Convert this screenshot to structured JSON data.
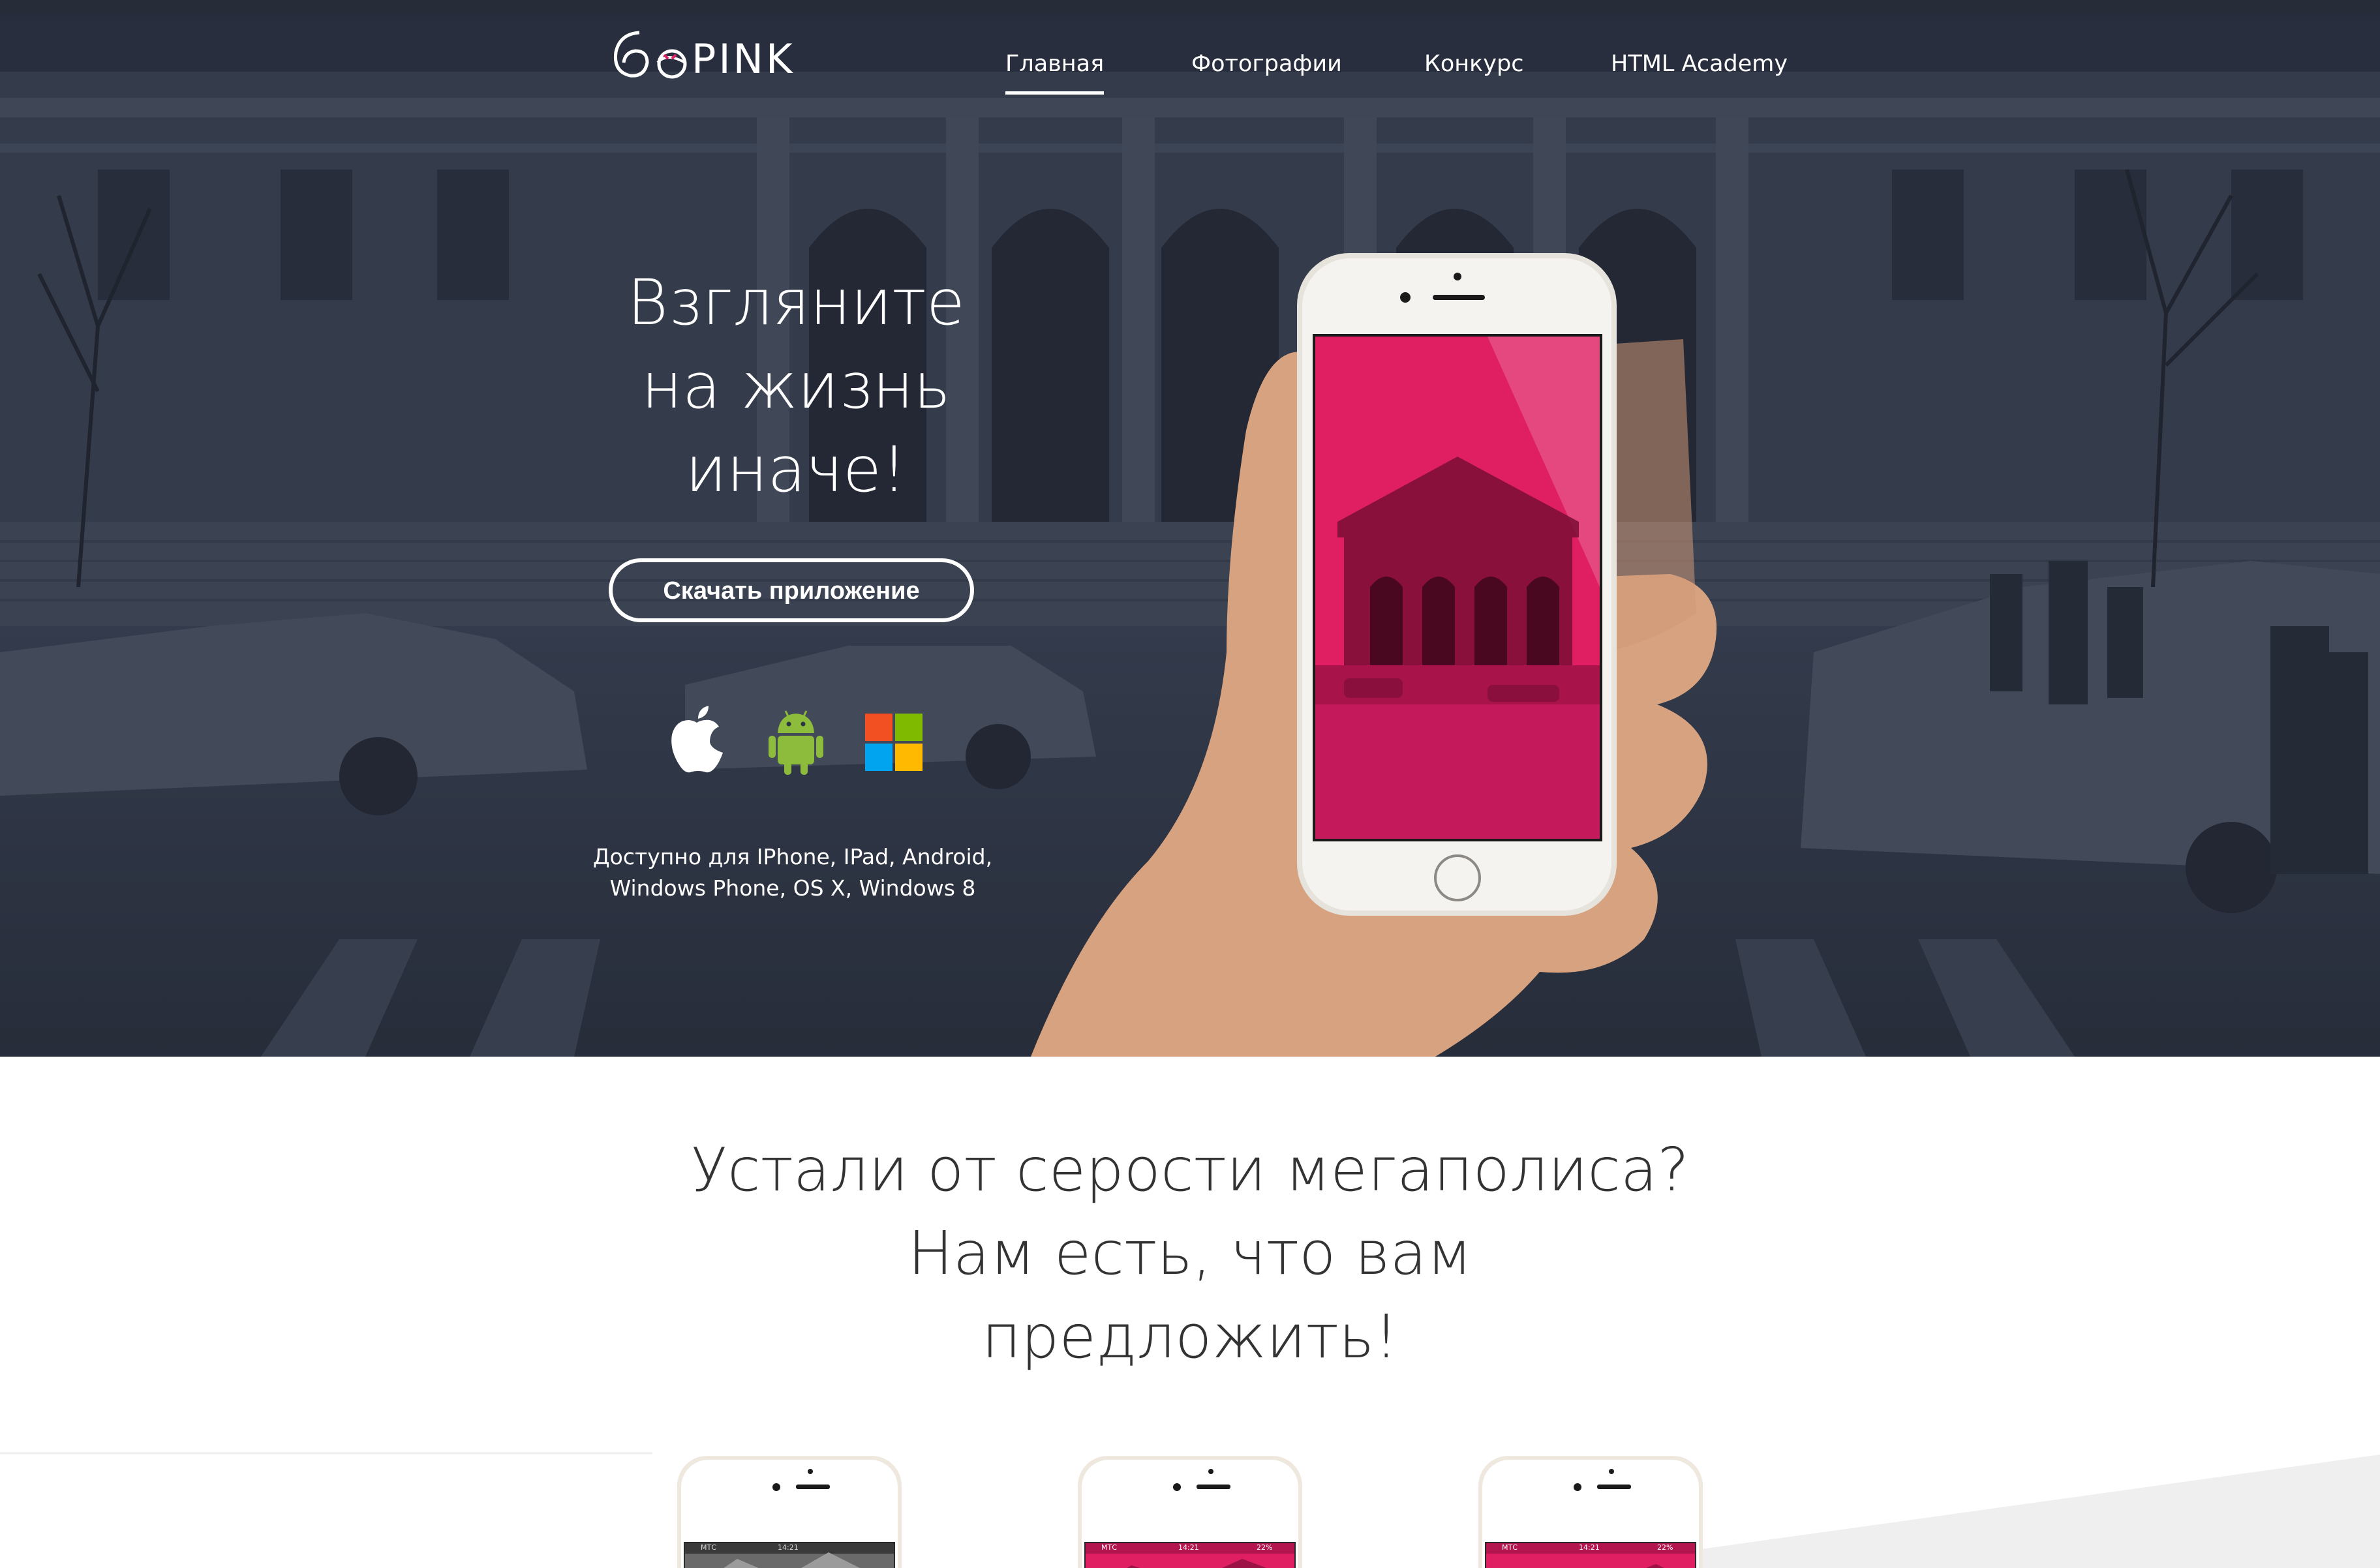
{
  "brand": {
    "logo_text": "PINK"
  },
  "nav": {
    "items": [
      {
        "label": "Главная",
        "active": true
      },
      {
        "label": "Фотографии",
        "active": false
      },
      {
        "label": "Конкурс",
        "active": false
      },
      {
        "label": "HTML Academy",
        "active": false
      }
    ]
  },
  "hero": {
    "headline_lines": [
      "Взгляните",
      "на жизнь",
      "иначе!"
    ],
    "download_button": "Скачать приложение",
    "platforms": [
      "apple-icon",
      "android-icon",
      "windows-icon"
    ],
    "available_lines": [
      "Доступно для IPhone, IPad, Android,",
      "Windows Phone, OS X, Windows 8"
    ]
  },
  "features": {
    "slogan_lines": [
      "Устали от серости мегаполиса?",
      "Нам есть, что вам",
      "предложить!"
    ],
    "phones": [
      {
        "carrier": "МТС",
        "time": "14:21",
        "battery": ""
      },
      {
        "carrier": "МТС",
        "time": "14:21",
        "battery": "22%"
      },
      {
        "carrier": "МТС",
        "time": "14:21",
        "battery": "22%"
      }
    ]
  },
  "colors": {
    "accent_pink": "#e01f63",
    "hero_overlay": "#2c3444",
    "text_dark": "#333333",
    "white": "#ffffff"
  }
}
